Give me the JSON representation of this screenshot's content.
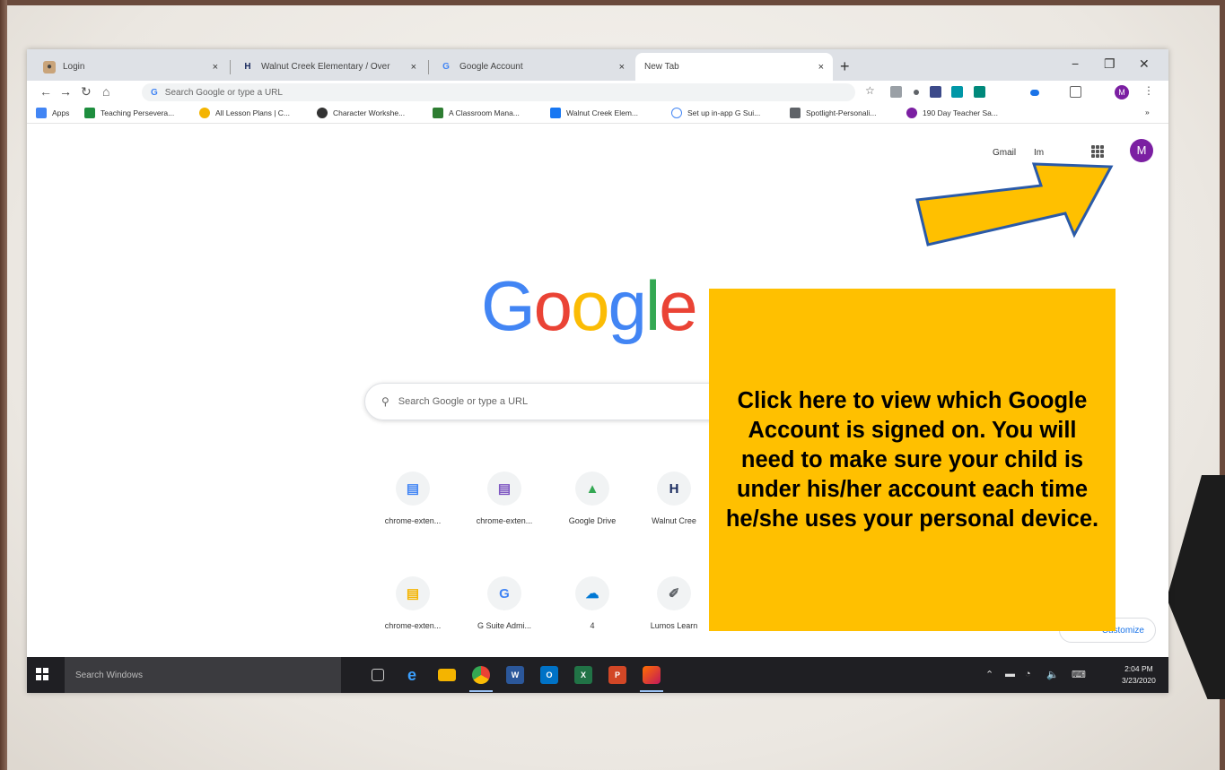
{
  "browser": {
    "tabs": [
      {
        "label": "Login"
      },
      {
        "label": "Walnut Creek Elementary / Over"
      },
      {
        "label": "Google Account"
      },
      {
        "label": "New Tab"
      }
    ],
    "new_tab_symbol": "+",
    "close_symbol": "×",
    "window_controls": {
      "minimize": "−",
      "restore": "❐",
      "close": "✕"
    },
    "omnibox_placeholder": "Search Google or type a URL",
    "profile_initial": "M",
    "bookmarks": [
      {
        "label": "Apps",
        "color": "#4285f4"
      },
      {
        "label": "Teaching Persevera...",
        "color": "#1e8e3e"
      },
      {
        "label": "All Lesson Plans | C...",
        "color": "#f4b400"
      },
      {
        "label": "Character Workshe...",
        "color": "#333333"
      },
      {
        "label": "A Classroom Mana...",
        "color": "#2e7d32"
      },
      {
        "label": "Walnut Creek Elem...",
        "color": "#1877f2"
      },
      {
        "label": "Set up in-app G Sui...",
        "color": "#4285f4"
      },
      {
        "label": "Spotlight-Personali...",
        "color": "#5f6368"
      },
      {
        "label": "190 Day Teacher Sa...",
        "color": "#7b1fa2"
      }
    ],
    "bookmarks_more": "»"
  },
  "newtab": {
    "gmail": "Gmail",
    "images": "Im",
    "profile_initial": "M",
    "logo_letters": [
      "G",
      "o",
      "o",
      "g",
      "l",
      "e"
    ],
    "logo_colors": [
      "#4285f4",
      "#ea4335",
      "#fbbc05",
      "#4285f4",
      "#34a853",
      "#ea4335"
    ],
    "search_placeholder": "Search Google or type a URL",
    "shortcuts": [
      {
        "label": "chrome-exten...",
        "glyph": "▤",
        "color": "#4285f4"
      },
      {
        "label": "chrome-exten...",
        "glyph": "▤",
        "color": "#7e57c2"
      },
      {
        "label": "Google Drive",
        "glyph": "▲",
        "color": "#34a853"
      },
      {
        "label": "Walnut Cree",
        "glyph": "H",
        "color": "#1a2b5f"
      },
      {
        "label": "chrome-exten...",
        "glyph": "▤",
        "color": "#f4b400"
      },
      {
        "label": "G Suite Admi...",
        "glyph": "G",
        "color": "#4285f4"
      },
      {
        "label": "4",
        "glyph": "☁",
        "color": "#0078d4"
      },
      {
        "label": "Lumos Learn",
        "glyph": "✐",
        "color": "#5f6368"
      }
    ],
    "customize_label": "Customize"
  },
  "taskbar": {
    "search_placeholder": "Search Windows",
    "time": "2:04 PM",
    "date": "3/23/2020",
    "apps": [
      {
        "name": "task-view",
        "color": "#1f1f23",
        "glyph": "▢"
      },
      {
        "name": "edge",
        "color": "#1f1f23",
        "glyph": "e"
      },
      {
        "name": "file-explorer",
        "color": "#f4b400",
        "glyph": ""
      },
      {
        "name": "chrome",
        "color": "#ea4335",
        "glyph": ""
      },
      {
        "name": "word",
        "color": "#2b579a",
        "glyph": "W"
      },
      {
        "name": "outlook",
        "color": "#0072c6",
        "glyph": "O"
      },
      {
        "name": "excel",
        "color": "#217346",
        "glyph": "X"
      },
      {
        "name": "powerpoint",
        "color": "#d24726",
        "glyph": "P"
      },
      {
        "name": "google-classroom",
        "color": "#ff6f00",
        "glyph": ""
      }
    ]
  },
  "callout": {
    "text": "Click here to view which Google Account is signed on. You will need to make sure your child is under his/her account each time he/she uses your personal device."
  },
  "colors": {
    "callout": "#ffc000",
    "arrow": "#ffc000",
    "profile": "#7b1fa2"
  }
}
